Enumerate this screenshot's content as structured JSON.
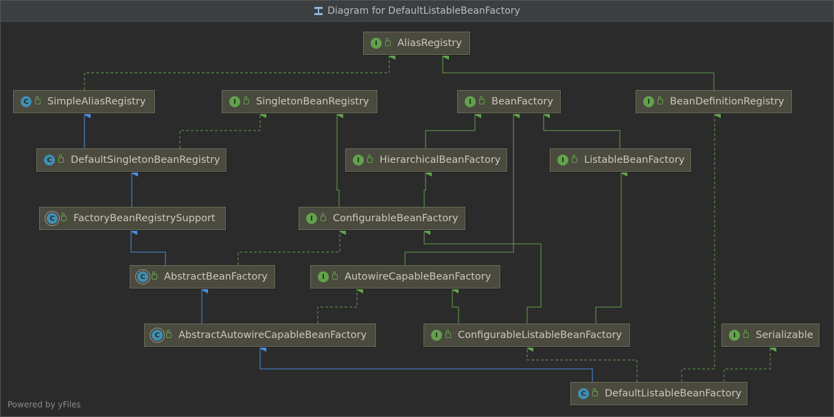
{
  "window": {
    "title": "Diagram for DefaultListableBeanFactory"
  },
  "nodes": {
    "alias_registry": {
      "label": "AliasRegistry",
      "kind": "I"
    },
    "simple_alias_registry": {
      "label": "SimpleAliasRegistry",
      "kind": "C"
    },
    "singleton_bean_registry": {
      "label": "SingletonBeanRegistry",
      "kind": "I"
    },
    "bean_factory": {
      "label": "BeanFactory",
      "kind": "I"
    },
    "bean_definition_registry": {
      "label": "BeanDefinitionRegistry",
      "kind": "I"
    },
    "default_singleton_bean_registry": {
      "label": "DefaultSingletonBeanRegistry",
      "kind": "C"
    },
    "hierarchical_bean_factory": {
      "label": "HierarchicalBeanFactory",
      "kind": "I"
    },
    "listable_bean_factory": {
      "label": "ListableBeanFactory",
      "kind": "I"
    },
    "factory_bean_registry_support": {
      "label": "FactoryBeanRegistrySupport",
      "kind": "C"
    },
    "configurable_bean_factory": {
      "label": "ConfigurableBeanFactory",
      "kind": "I"
    },
    "abstract_bean_factory": {
      "label": "AbstractBeanFactory",
      "kind": "C"
    },
    "autowire_capable_bean_factory": {
      "label": "AutowireCapableBeanFactory",
      "kind": "I"
    },
    "abstract_autowire_capable_bean_factory": {
      "label": "AbstractAutowireCapableBeanFactory",
      "kind": "C"
    },
    "configurable_listable_bean_factory": {
      "label": "ConfigurableListableBeanFactory",
      "kind": "I"
    },
    "serializable": {
      "label": "Serializable",
      "kind": "I"
    },
    "default_listable_bean_factory": {
      "label": "DefaultListableBeanFactory",
      "kind": "C"
    }
  },
  "colors": {
    "implements_edge": "#62a24a",
    "extends_edge": "#4a8fe0",
    "interface_badge": "#62a24a",
    "class_badge": "#3e8fb0"
  },
  "footer": {
    "text": "Powered by yFiles"
  }
}
